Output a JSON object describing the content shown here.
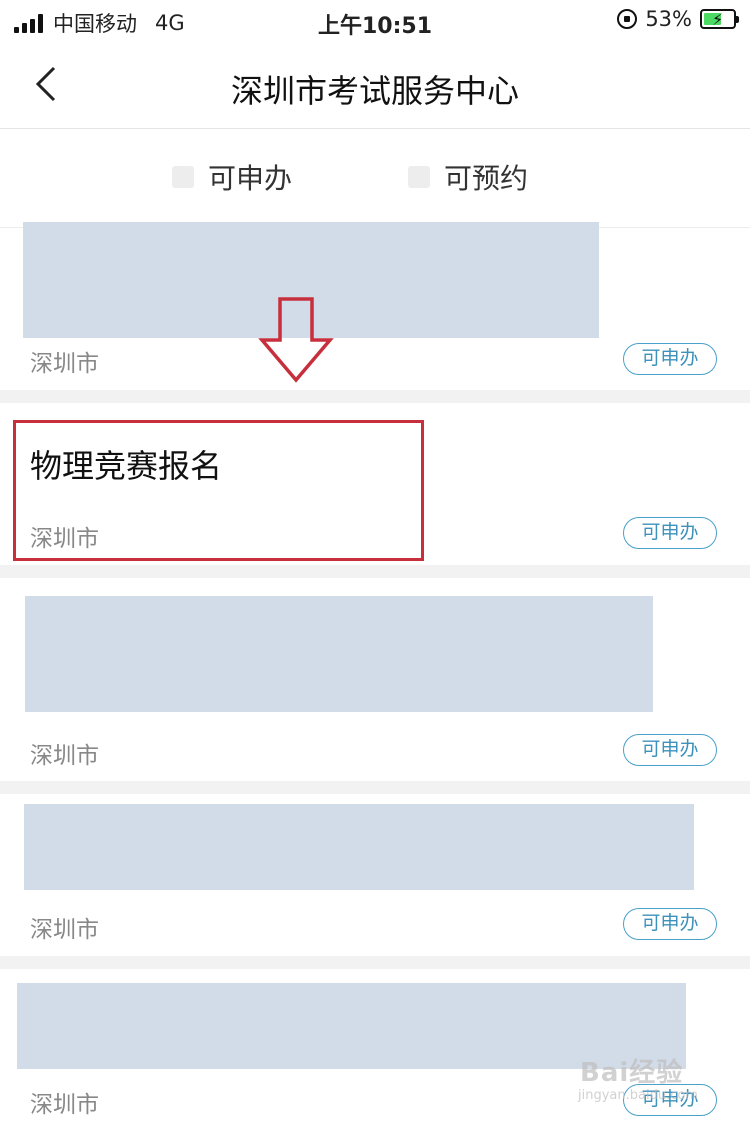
{
  "status_bar": {
    "carrier": "中国移动",
    "network": "4G",
    "time": "上午10:51",
    "battery": "53%",
    "battery_level": 0.53
  },
  "nav": {
    "title": "深圳市考试服务中心"
  },
  "filters": [
    {
      "label": "可申办"
    },
    {
      "label": "可预约"
    }
  ],
  "items": [
    {
      "title": "",
      "city": "深圳市",
      "tag": "可申办"
    },
    {
      "title": "物理竞赛报名",
      "city": "深圳市",
      "tag": "可申办"
    },
    {
      "title": "",
      "city": "深圳市",
      "tag": "可申办"
    },
    {
      "title": "",
      "city": "深圳市",
      "tag": "可申办"
    },
    {
      "title": "",
      "city": "深圳市",
      "tag": "可申办"
    }
  ],
  "watermark": {
    "text": "Bai经验",
    "sub": "jingyan.baidu.com"
  },
  "colors": {
    "tag": "#3d91bb",
    "highlight": "#c62f3b",
    "placeholder": "#d2dbe8"
  }
}
